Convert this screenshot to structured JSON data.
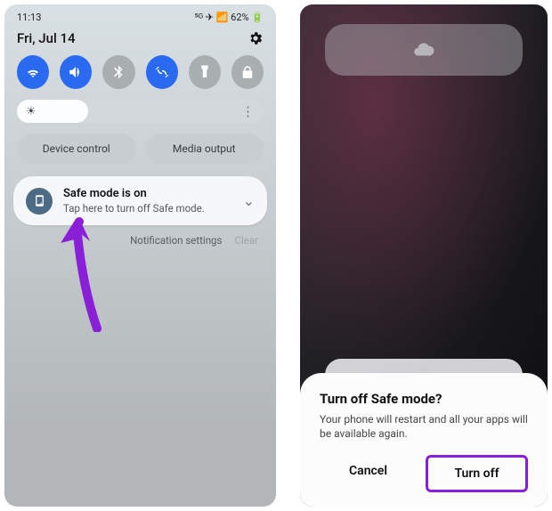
{
  "left": {
    "status": {
      "time": "11:13",
      "net": "⁵ᴳ ✈ 📶 62% 🔋"
    },
    "date": "Fri, Jul 14",
    "qs": [
      {
        "name": "wifi",
        "on": true
      },
      {
        "name": "sound",
        "on": true
      },
      {
        "name": "bluetooth",
        "on": false
      },
      {
        "name": "sync",
        "on": true
      },
      {
        "name": "flashlight",
        "on": false
      },
      {
        "name": "lock",
        "on": false
      }
    ],
    "chips": {
      "device": "Device control",
      "media": "Media output"
    },
    "notif": {
      "title": "Safe mode is on",
      "subtitle": "Tap here to turn off Safe mode."
    },
    "footer": {
      "settings": "Notification settings",
      "clear": "Clear"
    }
  },
  "right": {
    "dialog": {
      "title": "Turn off Safe mode?",
      "message": "Your phone will restart and all your apps will be available again.",
      "cancel": "Cancel",
      "confirm": "Turn off"
    }
  }
}
